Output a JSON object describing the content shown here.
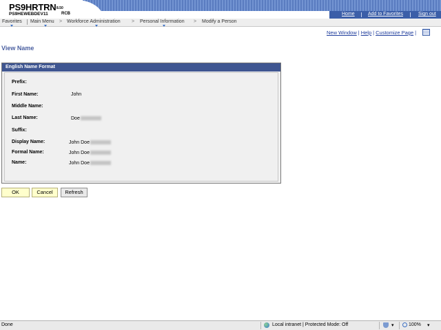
{
  "header": {
    "system_name": "PS9HRTRN",
    "system_version": "8.50",
    "database_name": "PS9HEWEBDEV11",
    "user_code": "RCB",
    "links": {
      "home": "Home",
      "add_to_favorites": "Add to Favorites",
      "sign_out": "Sign out"
    }
  },
  "nav": {
    "items": [
      "Favorites",
      "Main Menu",
      "Workforce Administration",
      "Personal Information",
      "Modify a Person"
    ],
    "separator": ">"
  },
  "page_links": {
    "new_window": "New Window",
    "help": "Help",
    "customize_page": "Customize Page",
    "divider": "|"
  },
  "page": {
    "title": "View Name"
  },
  "group": {
    "title": "English Name Format",
    "fields": {
      "prefix": {
        "label": "Prefix:",
        "value": ""
      },
      "first_name": {
        "label": "First Name:",
        "value": "John"
      },
      "middle_name": {
        "label": "Middle Name:",
        "value": ""
      },
      "last_name": {
        "label": "Last Name:",
        "value": "Doe"
      },
      "suffix": {
        "label": "Suffix:",
        "value": ""
      },
      "display_name": {
        "label": "Display Name:",
        "value": "John Doe"
      },
      "formal_name": {
        "label": "Formal Name:",
        "value": "John Doe"
      },
      "name": {
        "label": "Name:",
        "value": "John Doe"
      }
    }
  },
  "buttons": {
    "ok": "OK",
    "cancel": "Cancel",
    "refresh": "Refresh"
  },
  "status_bar": {
    "status": "Done",
    "zone": "Local intranet | Protected Mode: Off",
    "zoom": "100%"
  },
  "colors": {
    "header_band": "#5a7cc0",
    "group_header": "#3f5691",
    "title_text": "#4a5fa0",
    "primary_button": "#ffffcc"
  },
  "icons": [
    "globe-icon",
    "shield-icon",
    "zoom-icon",
    "grid-icon",
    "chevron-right-icon",
    "dropdown-triangle-icon"
  ]
}
